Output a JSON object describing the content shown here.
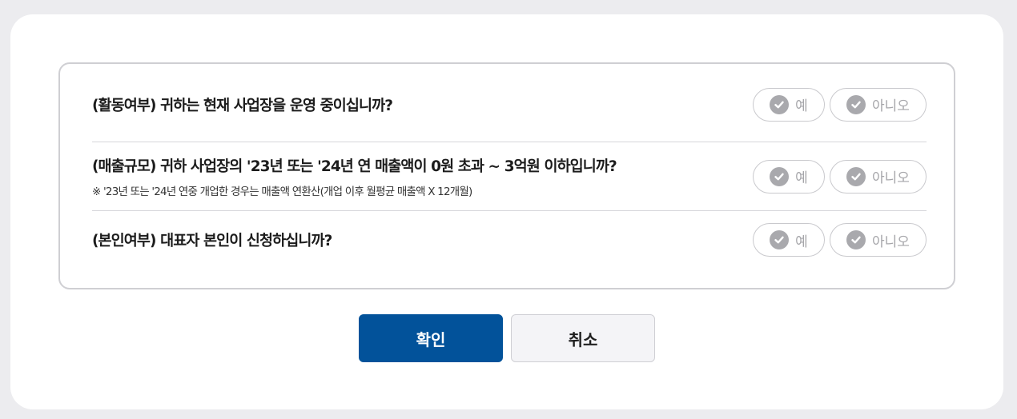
{
  "questions": [
    {
      "text": "(활동여부) 귀하는 현재 사업장을 운영 중이십니까?",
      "note": "",
      "yes_label": "예",
      "no_label": "아니오"
    },
    {
      "text": "(매출규모) 귀하 사업장의 '23년 또는 '24년 연 매출액이 0원 초과 ~ 3억원 이하입니까?",
      "note": "※ '23년 또는 '24년 연중 개업한 경우는 매출액 연환산(개업 이후 월평균 매출액 X 12개월)",
      "yes_label": "예",
      "no_label": "아니오"
    },
    {
      "text": "(본인여부) 대표자 본인이 신청하십니까?",
      "note": "",
      "yes_label": "예",
      "no_label": "아니오"
    }
  ],
  "actions": {
    "confirm_label": "확인",
    "cancel_label": "취소"
  },
  "colors": {
    "primary": "#02529a",
    "option_inactive": "#a9a9ad"
  }
}
